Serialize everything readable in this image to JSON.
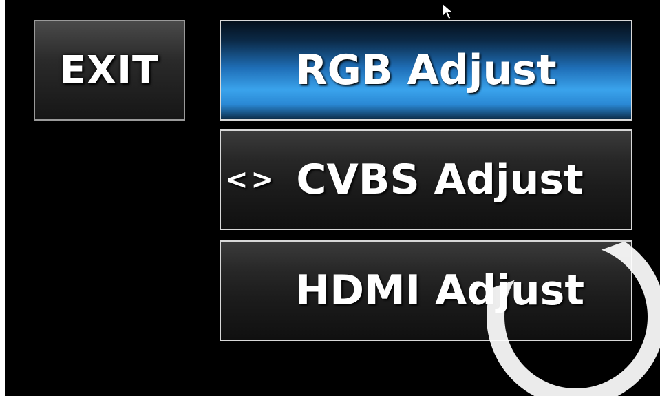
{
  "exit": {
    "label": "EXIT"
  },
  "menu": {
    "items": [
      {
        "label": "RGB Adjust",
        "state": "selected"
      },
      {
        "label": "CVBS Adjust",
        "state": "normal",
        "marker": "<>"
      },
      {
        "label": "HDMI Adjust",
        "state": "normal"
      }
    ]
  },
  "colors": {
    "background": "#000000",
    "selected": "#3aa3ec",
    "button": "#222222",
    "text": "#ffffff"
  },
  "icons": {
    "cursor": "mouse-pointer-icon"
  }
}
